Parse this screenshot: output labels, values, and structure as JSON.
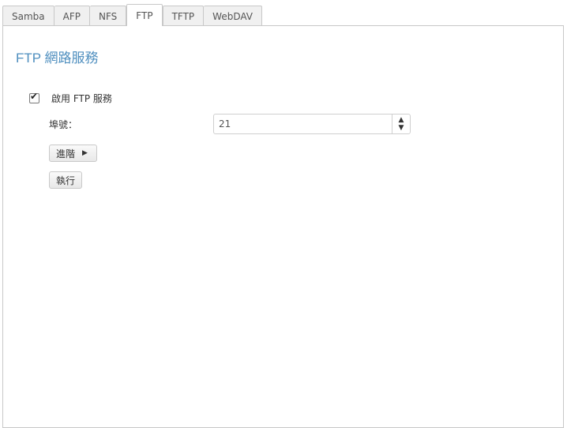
{
  "tabs": [
    {
      "label": "Samba",
      "active": false
    },
    {
      "label": "AFP",
      "active": false
    },
    {
      "label": "NFS",
      "active": false
    },
    {
      "label": "FTP",
      "active": true
    },
    {
      "label": "TFTP",
      "active": false
    },
    {
      "label": "WebDAV",
      "active": false
    }
  ],
  "panel": {
    "title": "FTP 網路服務",
    "enable": {
      "label": "啟用 FTP 服務",
      "checked": true
    },
    "port": {
      "label": "埠號：",
      "value": "21"
    },
    "advanced_label": "進階",
    "apply_label": "執行"
  },
  "colors": {
    "title": "#4f8fbf",
    "border": "#c8c8c8"
  }
}
